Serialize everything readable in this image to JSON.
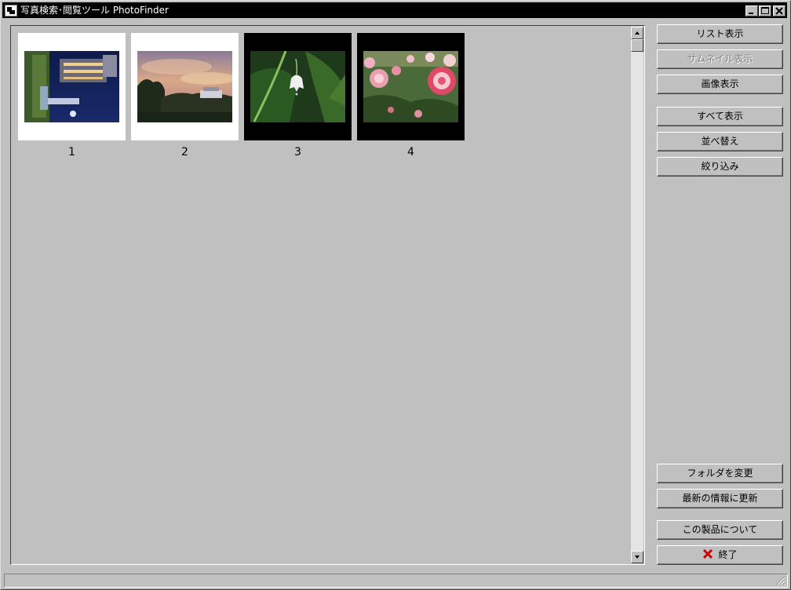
{
  "window": {
    "title": "写真検索･閲覧ツール PhotoFinder",
    "icon": "app-icon",
    "controls": [
      "minimize-icon",
      "maximize-icon",
      "close-icon"
    ]
  },
  "thumbnails": [
    {
      "label": "1",
      "frame_color": "#ffffff",
      "photo": "night-waterfront-rotated"
    },
    {
      "label": "2",
      "frame_color": "#ffffff",
      "photo": "sunset-sky-houses"
    },
    {
      "label": "3",
      "frame_color": "#000000",
      "photo": "white-bell-flower"
    },
    {
      "label": "4",
      "frame_color": "#000000",
      "photo": "pink-roses"
    }
  ],
  "sidebar": {
    "list_view": "リスト表示",
    "thumbnail_view": "サムネイル表示",
    "image_view": "画像表示",
    "show_all": "すべて表示",
    "sort": "並べ替え",
    "filter": "絞り込み",
    "change_folder": "フォルダを変更",
    "refresh": "最新の情報に更新",
    "about": "この製品について",
    "exit": "終了"
  },
  "colors": {
    "window_bg": "#c0c0c0",
    "titlebar_bg": "#000000",
    "exit_icon": "#cc0000"
  }
}
